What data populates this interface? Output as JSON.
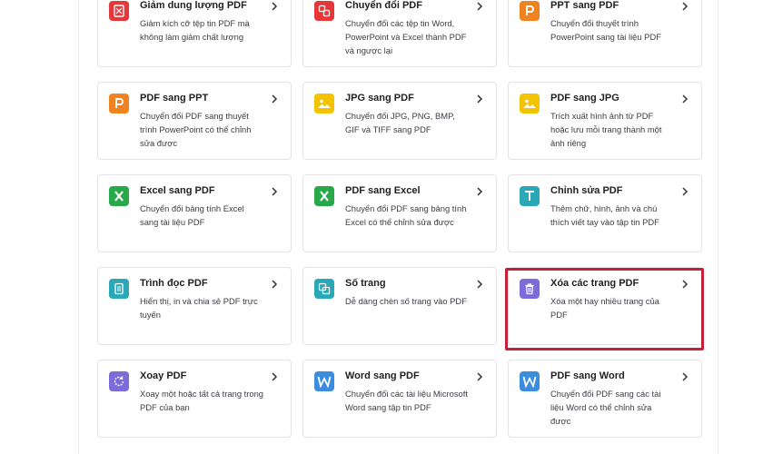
{
  "colors": {
    "highlight": "#c5203a",
    "red": "#e5383b",
    "orange": "#f0821f",
    "yellow": "#f3c300",
    "green": "#27a849",
    "teal": "#2aa8b8",
    "purple": "#7c6cd9",
    "blue": "#3c8de0"
  },
  "tools": [
    {
      "id": "compress",
      "icon": "compress-icon",
      "title": "Giảm dung lượng PDF",
      "desc": "Giảm kích cỡ tệp tin PDF mà không làm giảm chất lượng"
    },
    {
      "id": "convert",
      "icon": "convert-icon",
      "title": "Chuyển đổi PDF",
      "desc": "Chuyển đổi các tệp tin Word, PowerPoint và Excel thành PDF và ngược lại"
    },
    {
      "id": "ppt-to-pdf",
      "icon": "powerpoint-icon",
      "title": "PPT sang PDF",
      "desc": "Chuyển đổi thuyết trình PowerPoint sang tài liệu PDF"
    },
    {
      "id": "pdf-to-ppt",
      "icon": "powerpoint-icon",
      "title": "PDF sang PPT",
      "desc": "Chuyển đổi PDF sang thuyết trình PowerPoint có thể chỉnh sửa được"
    },
    {
      "id": "jpg-to-pdf",
      "icon": "image-icon",
      "title": "JPG sang PDF",
      "desc": "Chuyển đổi JPG, PNG, BMP, GIF và TIFF sang PDF"
    },
    {
      "id": "pdf-to-jpg",
      "icon": "image-icon",
      "title": "PDF sang JPG",
      "desc": "Trích xuất hình ảnh từ PDF hoặc lưu mỗi trang thành một ảnh riêng"
    },
    {
      "id": "excel-to-pdf",
      "icon": "excel-icon",
      "title": "Excel sang PDF",
      "desc": "Chuyển đổi bảng tính Excel sang tài liệu PDF"
    },
    {
      "id": "pdf-to-excel",
      "icon": "excel-icon",
      "title": "PDF sang Excel",
      "desc": "Chuyển đổi PDF sang bảng tính Excel có thể chỉnh sửa được"
    },
    {
      "id": "edit",
      "icon": "text-edit-icon",
      "title": "Chỉnh sửa PDF",
      "desc": "Thêm chữ, hình, ảnh và chú thích viết tay vào tập tin PDF"
    },
    {
      "id": "reader",
      "icon": "document-icon",
      "title": "Trình đọc PDF",
      "desc": "Hiển thị, in và chia sẻ PDF trực tuyến"
    },
    {
      "id": "page-numbers",
      "icon": "page-number-icon",
      "title": "Số trang",
      "desc": "Dễ dàng chèn số trang vào PDF"
    },
    {
      "id": "delete-pages",
      "icon": "trash-icon",
      "title": "Xóa các trang PDF",
      "desc": "Xóa một hay nhiều trang của PDF"
    },
    {
      "id": "rotate",
      "icon": "rotate-icon",
      "title": "Xoay PDF",
      "desc": "Xoay một hoặc tất cả trang trong PDF của bạn"
    },
    {
      "id": "word-to-pdf",
      "icon": "word-icon",
      "title": "Word sang PDF",
      "desc": "Chuyển đổi các tài liệu Microsoft Word sang tập tin PDF"
    },
    {
      "id": "pdf-to-word",
      "icon": "word-icon",
      "title": "PDF sang Word",
      "desc": "Chuyển đổi PDF sang các tài liệu Word có thể chỉnh sửa được"
    }
  ]
}
